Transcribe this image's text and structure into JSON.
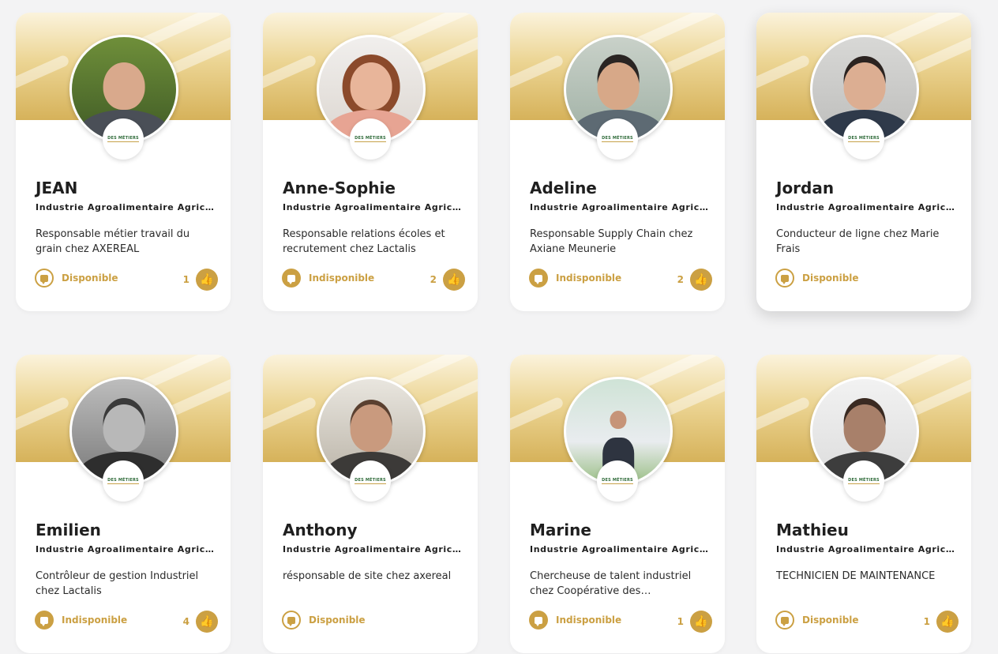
{
  "logo_text": "DES MÉTIERS",
  "colors": {
    "accent": "#cba043",
    "banner_light": "#fbf3dc",
    "banner_dark": "#d6b25a"
  },
  "profiles": [
    {
      "name": "JEAN",
      "sector": "Industrie Agroalimentaire Agricu…",
      "description": "Responsable métier travail du grain chez AXEREAL",
      "status": "Disponible",
      "status_style": "outline",
      "likes": "1"
    },
    {
      "name": "Anne-Sophie",
      "sector": "Industrie Agroalimentaire Agricu…",
      "description": "Responsable relations écoles et recrutement chez Lactalis",
      "status": "Indisponible",
      "status_style": "solid",
      "likes": "2"
    },
    {
      "name": "Adeline",
      "sector": "Industrie Agroalimentaire Agricu…",
      "description": "Responsable Supply Chain chez Axiane Meunerie",
      "status": "Indisponible",
      "status_style": "solid",
      "likes": "2"
    },
    {
      "name": "Jordan",
      "sector": "Industrie Agroalimentaire Agricu…",
      "description": "Conducteur de ligne chez Marie Frais",
      "status": "Disponible",
      "status_style": "outline",
      "likes": ""
    },
    {
      "name": "Emilien",
      "sector": "Industrie Agroalimentaire Agricu…",
      "description": "Contrôleur de gestion Industriel chez Lactalis",
      "status": "Indisponible",
      "status_style": "solid",
      "likes": "4"
    },
    {
      "name": "Anthony",
      "sector": "Industrie Agroalimentaire Agricu…",
      "description": "résponsable de site chez axereal",
      "status": "Disponible",
      "status_style": "outline",
      "likes": ""
    },
    {
      "name": "Marine",
      "sector": "Industrie Agroalimentaire Agricu…",
      "description": "Chercheuse de talent industriel chez Coopérative des producteur…",
      "status": "Indisponible",
      "status_style": "solid",
      "likes": "1"
    },
    {
      "name": "Mathieu",
      "sector": "Industrie Agroalimentaire Agricu…",
      "description": "TECHNICIEN DE MAINTENANCE",
      "status": "Disponible",
      "status_style": "outline",
      "likes": "1"
    }
  ]
}
